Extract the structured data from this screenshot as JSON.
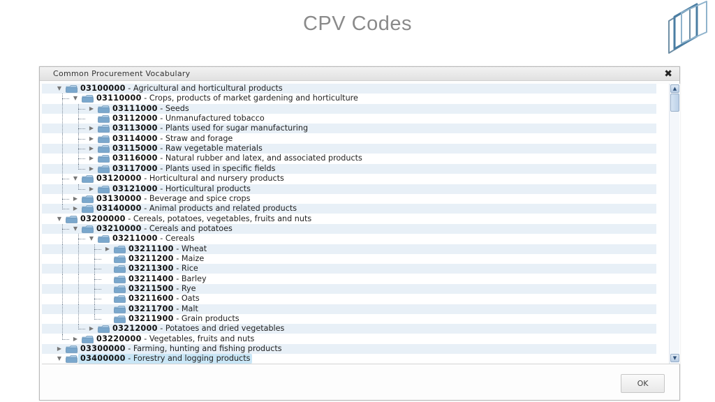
{
  "slide": {
    "title": "CPV Codes"
  },
  "dialog": {
    "title": "Common Procurement Vocabulary",
    "close_icon": "close-icon",
    "ok_label": "OK"
  },
  "tree": {
    "separator": " - ",
    "rows": [
      {
        "code": "03100000",
        "label": "Agricultural and horticultural products",
        "depth": 0,
        "toggle": "expanded",
        "last": false,
        "selected": false
      },
      {
        "code": "03110000",
        "label": "Crops, products of market gardening and horticulture",
        "depth": 1,
        "toggle": "expanded",
        "last": false,
        "selected": false
      },
      {
        "code": "03111000",
        "label": "Seeds",
        "depth": 2,
        "toggle": "collapsed",
        "last": false,
        "selected": false
      },
      {
        "code": "03112000",
        "label": "Unmanufactured tobacco",
        "depth": 2,
        "toggle": "none",
        "last": false,
        "selected": false
      },
      {
        "code": "03113000",
        "label": "Plants used for sugar manufacturing",
        "depth": 2,
        "toggle": "collapsed",
        "last": false,
        "selected": false
      },
      {
        "code": "03114000",
        "label": "Straw and forage",
        "depth": 2,
        "toggle": "collapsed",
        "last": false,
        "selected": false
      },
      {
        "code": "03115000",
        "label": "Raw vegetable materials",
        "depth": 2,
        "toggle": "collapsed",
        "last": false,
        "selected": false
      },
      {
        "code": "03116000",
        "label": "Natural rubber and latex, and associated products",
        "depth": 2,
        "toggle": "collapsed",
        "last": false,
        "selected": false
      },
      {
        "code": "03117000",
        "label": "Plants used in specific fields",
        "depth": 2,
        "toggle": "collapsed",
        "last": true,
        "selected": false
      },
      {
        "code": "03120000",
        "label": "Horticultural and nursery products",
        "depth": 1,
        "toggle": "expanded",
        "last": false,
        "selected": false
      },
      {
        "code": "03121000",
        "label": "Horticultural products",
        "depth": 2,
        "toggle": "collapsed",
        "last": true,
        "selected": false
      },
      {
        "code": "03130000",
        "label": "Beverage and spice crops",
        "depth": 1,
        "toggle": "collapsed",
        "last": false,
        "selected": false
      },
      {
        "code": "03140000",
        "label": "Animal products and related products",
        "depth": 1,
        "toggle": "collapsed",
        "last": true,
        "selected": false
      },
      {
        "code": "03200000",
        "label": "Cereals, potatoes, vegetables, fruits and nuts",
        "depth": 0,
        "toggle": "expanded",
        "last": false,
        "selected": false
      },
      {
        "code": "03210000",
        "label": "Cereals and potatoes",
        "depth": 1,
        "toggle": "expanded",
        "last": false,
        "selected": false
      },
      {
        "code": "03211000",
        "label": "Cereals",
        "depth": 2,
        "toggle": "expanded",
        "last": false,
        "selected": false
      },
      {
        "code": "03211100",
        "label": "Wheat",
        "depth": 3,
        "toggle": "collapsed",
        "last": false,
        "selected": false
      },
      {
        "code": "03211200",
        "label": "Maize",
        "depth": 3,
        "toggle": "none",
        "last": false,
        "selected": false
      },
      {
        "code": "03211300",
        "label": "Rice",
        "depth": 3,
        "toggle": "none",
        "last": false,
        "selected": false
      },
      {
        "code": "03211400",
        "label": "Barley",
        "depth": 3,
        "toggle": "none",
        "last": false,
        "selected": false
      },
      {
        "code": "03211500",
        "label": "Rye",
        "depth": 3,
        "toggle": "none",
        "last": false,
        "selected": false
      },
      {
        "code": "03211600",
        "label": "Oats",
        "depth": 3,
        "toggle": "none",
        "last": false,
        "selected": false
      },
      {
        "code": "03211700",
        "label": "Malt",
        "depth": 3,
        "toggle": "none",
        "last": false,
        "selected": false
      },
      {
        "code": "03211900",
        "label": "Grain products",
        "depth": 3,
        "toggle": "none",
        "last": true,
        "selected": false
      },
      {
        "code": "03212000",
        "label": "Potatoes and dried vegetables",
        "depth": 2,
        "toggle": "collapsed",
        "last": true,
        "selected": false
      },
      {
        "code": "03220000",
        "label": "Vegetables, fruits and nuts",
        "depth": 1,
        "toggle": "collapsed",
        "last": true,
        "selected": false
      },
      {
        "code": "03300000",
        "label": "Farming, hunting and fishing products",
        "depth": 0,
        "toggle": "collapsed",
        "last": false,
        "selected": false
      },
      {
        "code": "03400000",
        "label": "Forestry and logging products",
        "depth": 0,
        "toggle": "expanded",
        "last": true,
        "selected": true
      }
    ]
  },
  "scrollbar": {
    "position": 0
  },
  "colors": {
    "folder_body": "#7aa7cc",
    "folder_top": "#a9c9e3",
    "row_alt": "#e8f0f7",
    "selection": "#c9e6f6"
  }
}
